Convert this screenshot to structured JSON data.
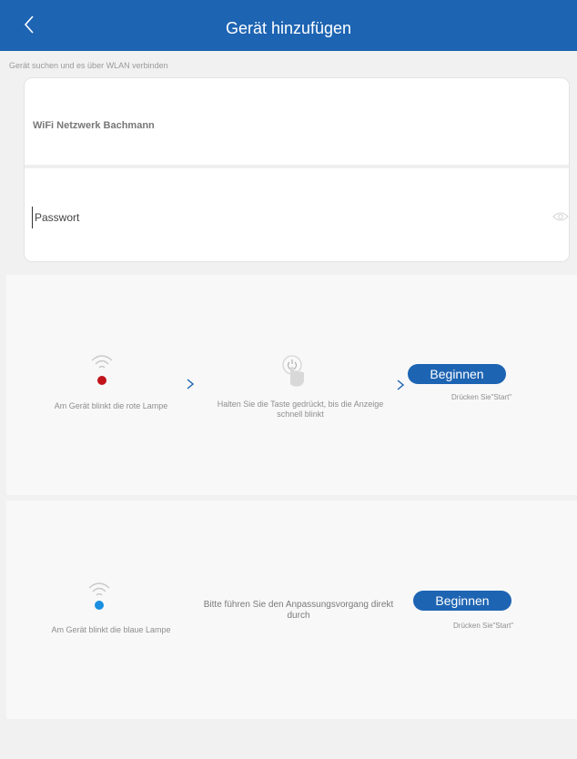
{
  "header": {
    "title": "Gerät hinzufügen",
    "back_icon": "chevron-left-icon",
    "background": "#1d64b3"
  },
  "wlan": {
    "label": "Gerät suchen und es über WLAN verbinden",
    "ssid": "WiFi Netzwerk Bachmann",
    "password_placeholder": "Passwort",
    "eye_icon": "eye-icon"
  },
  "red_mode": {
    "lamp_text": "Am Gerät blinkt die rote Lampe",
    "lamp_color": "#c0141a",
    "press_text_1": "Halten Sie die Taste gedrückt, bis die Anzeige",
    "press_text_2": "schnell blinkt",
    "start_label": "Beginnen",
    "hint": "Drücken Sie\"Start\""
  },
  "blue_mode": {
    "lamp_text": "Am Gerät blinkt die blaue Lampe",
    "lamp_color": "#1a8fe0",
    "instruction_1": "Bitte führen Sie den Anpassungsvorgang direkt",
    "instruction_2": "durch",
    "start_label": "Beginnen",
    "hint": "Drücken Sie\"Start\""
  }
}
